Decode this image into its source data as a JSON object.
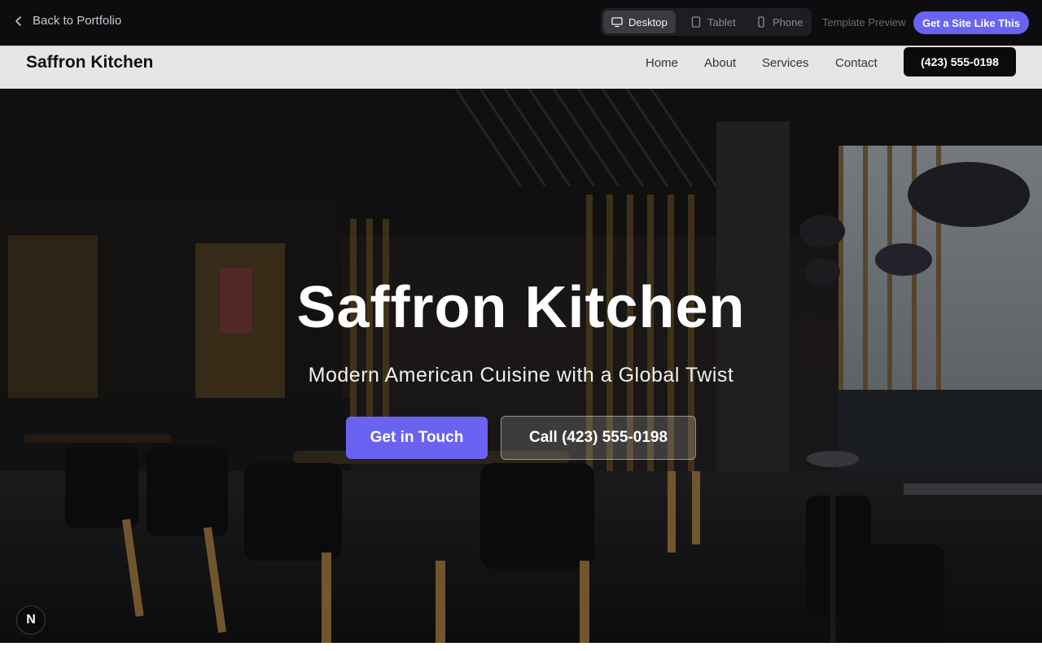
{
  "preview_bar": {
    "back_label": "Back to Portfolio",
    "devices": [
      {
        "label": "Desktop",
        "icon": "desktop-icon",
        "active": true
      },
      {
        "label": "Tablet",
        "icon": "tablet-icon",
        "active": false
      },
      {
        "label": "Phone",
        "icon": "phone-icon",
        "active": false
      }
    ],
    "template_label": "Template Preview",
    "cta_label": "Get a Site Like This"
  },
  "site_nav": {
    "brand": "Saffron Kitchen",
    "links": [
      "Home",
      "About",
      "Services",
      "Contact"
    ],
    "phone_button": "(423) 555-0198"
  },
  "hero": {
    "title": "Saffron Kitchen",
    "subtitle": "Modern American Cuisine with a Global Twist",
    "primary_button": "Get in Touch",
    "secondary_button": "Call (423) 555-0198"
  },
  "badge": {
    "letter": "N"
  },
  "colors": {
    "accent": "#6a63f2",
    "topbar_bg": "#0d0d0f",
    "nav_bg": "#e6e6e6"
  }
}
